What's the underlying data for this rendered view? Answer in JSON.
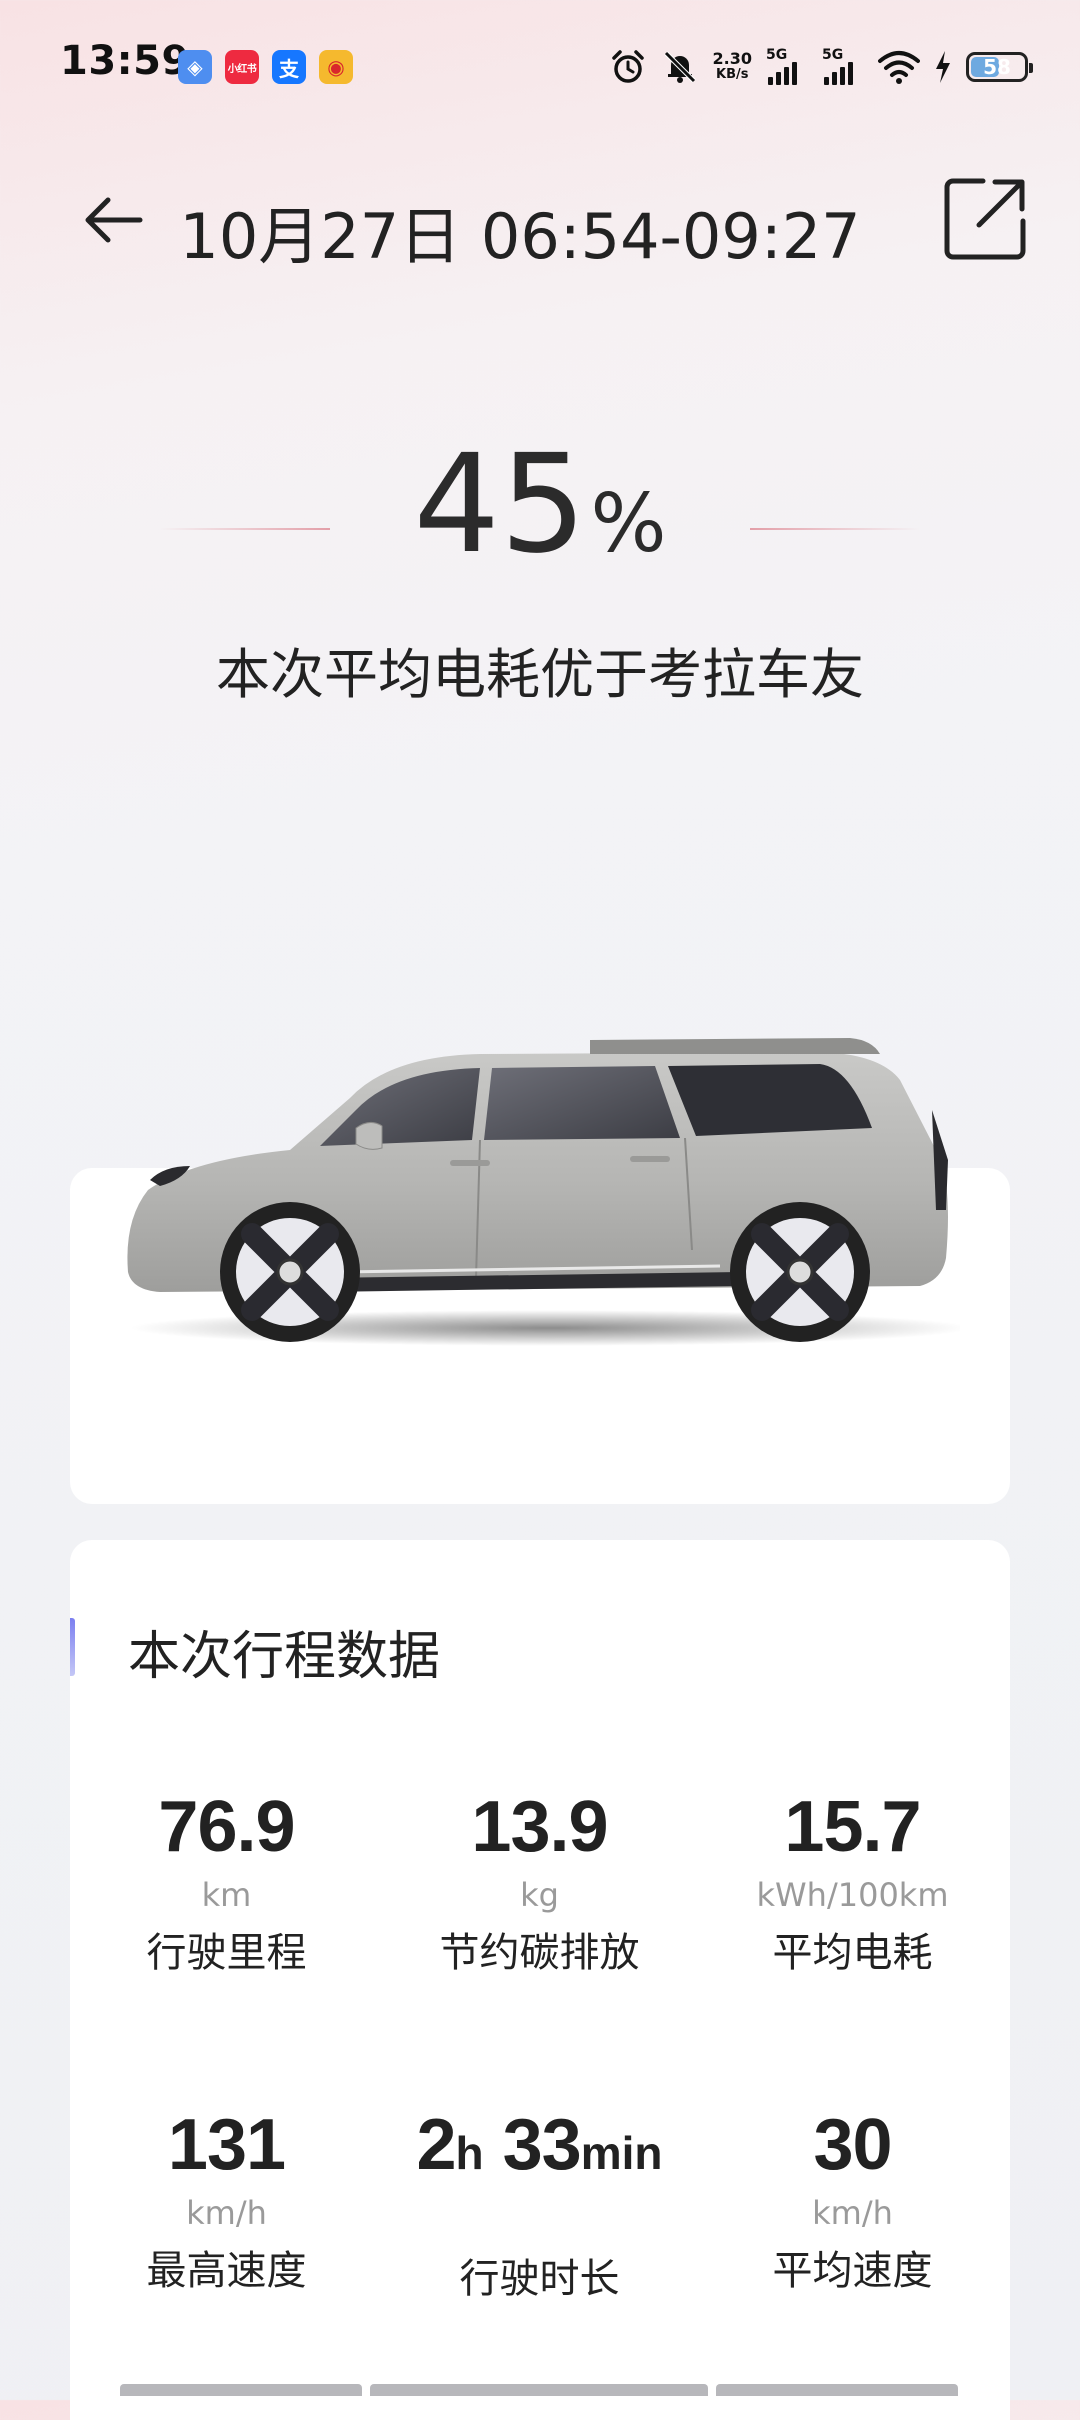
{
  "status_bar": {
    "time": "13:59",
    "app_icons": [
      {
        "name": "map-app-icon",
        "glyph": "◈",
        "color": "#4e8ef0"
      },
      {
        "name": "xiaohongshu-icon",
        "glyph": "小红书",
        "color": "#ee2a40"
      },
      {
        "name": "alipay-icon",
        "glyph": "支",
        "color": "#1677ff"
      },
      {
        "name": "weibo-icon",
        "glyph": "◉",
        "color": "#f5b92e"
      }
    ],
    "net_speed_value": "2.30",
    "net_speed_unit": "KB/s",
    "sim1_label": "5G",
    "sim2_label": "5G",
    "battery_level": "58"
  },
  "header": {
    "title": "10月27日 06:54-09:27"
  },
  "hero": {
    "value": "45",
    "unit": "%",
    "subtitle": "本次平均电耗优于考拉车友"
  },
  "trip": {
    "title": "本次行程数据",
    "stats": [
      {
        "value": "76.9",
        "unit": "km",
        "label": "行驶里程"
      },
      {
        "value": "13.9",
        "unit": "kg",
        "label": "节约碳排放"
      },
      {
        "value": "15.7",
        "unit": "kWh/100km",
        "label": "平均电耗"
      },
      {
        "value": "131",
        "unit": "km/h",
        "label": "最高速度"
      },
      {
        "hours": "2",
        "hours_unit": "h",
        "minutes": "33",
        "minutes_unit": "min",
        "unit": "",
        "label": "行驶时长"
      },
      {
        "value": "30",
        "unit": "km/h",
        "label": "平均速度"
      }
    ]
  },
  "colors": {
    "accent": "#7b7ff0",
    "battery_fill": "#6ea9e0",
    "car_body": "#b9b9b7"
  }
}
